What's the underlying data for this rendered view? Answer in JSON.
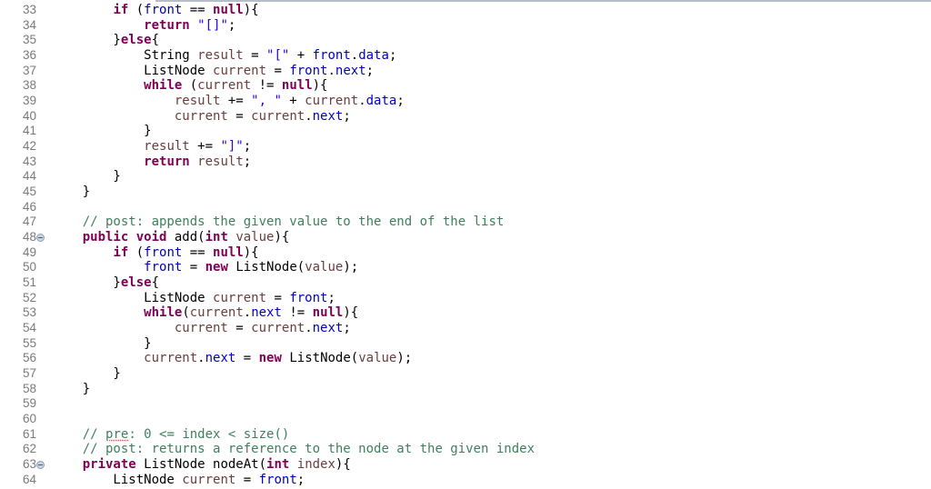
{
  "editor": {
    "fold_marker_lines": [
      48,
      63
    ],
    "accent_colors": {
      "keyword": "#7f0055",
      "field": "#0000c0",
      "string": "#2a00ff",
      "local_variable": "#6a3e3e",
      "comment": "#3f7f5f",
      "line_number": "#7a7a7a"
    },
    "lines": [
      {
        "n": "33",
        "tokens": [
          [
            "",
            "        "
          ],
          [
            "kw",
            "if"
          ],
          [
            "",
            " ("
          ],
          [
            "fd",
            "front"
          ],
          [
            "",
            " == "
          ],
          [
            "kw",
            "null"
          ],
          [
            "",
            "){"
          ]
        ]
      },
      {
        "n": "34",
        "tokens": [
          [
            "",
            "            "
          ],
          [
            "kw",
            "return"
          ],
          [
            "",
            " "
          ],
          [
            "st",
            "\"[]\""
          ],
          [
            "",
            ";"
          ]
        ]
      },
      {
        "n": "35",
        "tokens": [
          [
            "",
            "        }"
          ],
          [
            "kw",
            "else"
          ],
          [
            "",
            "{"
          ]
        ]
      },
      {
        "n": "36",
        "tokens": [
          [
            "",
            "            String "
          ],
          [
            "lv",
            "result"
          ],
          [
            "",
            " = "
          ],
          [
            "st",
            "\"[\""
          ],
          [
            "",
            " + "
          ],
          [
            "fd",
            "front"
          ],
          [
            "",
            "."
          ],
          [
            "fd",
            "data"
          ],
          [
            "",
            ";"
          ]
        ]
      },
      {
        "n": "37",
        "tokens": [
          [
            "",
            "            ListNode "
          ],
          [
            "lv",
            "current"
          ],
          [
            "",
            " = "
          ],
          [
            "fd",
            "front"
          ],
          [
            "",
            "."
          ],
          [
            "fd",
            "next"
          ],
          [
            "",
            ";"
          ]
        ]
      },
      {
        "n": "38",
        "tokens": [
          [
            "",
            "            "
          ],
          [
            "kw",
            "while"
          ],
          [
            "",
            " ("
          ],
          [
            "lv",
            "current"
          ],
          [
            "",
            " != "
          ],
          [
            "kw",
            "null"
          ],
          [
            "",
            "){"
          ]
        ]
      },
      {
        "n": "39",
        "tokens": [
          [
            "",
            "                "
          ],
          [
            "lv",
            "result"
          ],
          [
            "",
            " += "
          ],
          [
            "st",
            "\", \""
          ],
          [
            "",
            " + "
          ],
          [
            "lv",
            "current"
          ],
          [
            "",
            "."
          ],
          [
            "fd",
            "data"
          ],
          [
            "",
            ";"
          ]
        ]
      },
      {
        "n": "40",
        "tokens": [
          [
            "",
            "                "
          ],
          [
            "lv",
            "current"
          ],
          [
            "",
            " = "
          ],
          [
            "lv",
            "current"
          ],
          [
            "",
            "."
          ],
          [
            "fd",
            "next"
          ],
          [
            "",
            ";"
          ]
        ]
      },
      {
        "n": "41",
        "tokens": [
          [
            "",
            "            }"
          ]
        ]
      },
      {
        "n": "42",
        "tokens": [
          [
            "",
            "            "
          ],
          [
            "lv",
            "result"
          ],
          [
            "",
            " += "
          ],
          [
            "st",
            "\"]\""
          ],
          [
            "",
            ";"
          ]
        ]
      },
      {
        "n": "43",
        "tokens": [
          [
            "",
            "            "
          ],
          [
            "kw",
            "return"
          ],
          [
            "",
            " "
          ],
          [
            "lv",
            "result"
          ],
          [
            "",
            ";"
          ]
        ]
      },
      {
        "n": "44",
        "tokens": [
          [
            "",
            "        }"
          ]
        ]
      },
      {
        "n": "45",
        "tokens": [
          [
            "",
            "    }"
          ]
        ]
      },
      {
        "n": "46",
        "tokens": []
      },
      {
        "n": "47",
        "tokens": [
          [
            "",
            "    "
          ],
          [
            "cm",
            "// post: appends the given value to the end of the list"
          ]
        ]
      },
      {
        "n": "48",
        "tokens": [
          [
            "",
            "    "
          ],
          [
            "kw",
            "public"
          ],
          [
            "",
            " "
          ],
          [
            "kw",
            "void"
          ],
          [
            "",
            " add("
          ],
          [
            "kw",
            "int"
          ],
          [
            "",
            " "
          ],
          [
            "lv",
            "value"
          ],
          [
            "",
            "){"
          ]
        ]
      },
      {
        "n": "49",
        "tokens": [
          [
            "",
            "        "
          ],
          [
            "kw",
            "if"
          ],
          [
            "",
            " ("
          ],
          [
            "fd",
            "front"
          ],
          [
            "",
            " == "
          ],
          [
            "kw",
            "null"
          ],
          [
            "",
            "){"
          ]
        ]
      },
      {
        "n": "50",
        "tokens": [
          [
            "",
            "            "
          ],
          [
            "fd",
            "front"
          ],
          [
            "",
            " = "
          ],
          [
            "kw",
            "new"
          ],
          [
            "",
            " ListNode("
          ],
          [
            "lv",
            "value"
          ],
          [
            "",
            ");"
          ]
        ]
      },
      {
        "n": "51",
        "tokens": [
          [
            "",
            "        }"
          ],
          [
            "kw",
            "else"
          ],
          [
            "",
            "{"
          ]
        ]
      },
      {
        "n": "52",
        "tokens": [
          [
            "",
            "            ListNode "
          ],
          [
            "lv",
            "current"
          ],
          [
            "",
            " = "
          ],
          [
            "fd",
            "front"
          ],
          [
            "",
            ";"
          ]
        ]
      },
      {
        "n": "53",
        "tokens": [
          [
            "",
            "            "
          ],
          [
            "kw",
            "while"
          ],
          [
            "",
            "("
          ],
          [
            "lv",
            "current"
          ],
          [
            "",
            "."
          ],
          [
            "fd",
            "next"
          ],
          [
            "",
            " != "
          ],
          [
            "kw",
            "null"
          ],
          [
            "",
            "){"
          ]
        ]
      },
      {
        "n": "54",
        "tokens": [
          [
            "",
            "                "
          ],
          [
            "lv",
            "current"
          ],
          [
            "",
            " = "
          ],
          [
            "lv",
            "current"
          ],
          [
            "",
            "."
          ],
          [
            "fd",
            "next"
          ],
          [
            "",
            ";"
          ]
        ]
      },
      {
        "n": "55",
        "tokens": [
          [
            "",
            "            }"
          ]
        ]
      },
      {
        "n": "56",
        "tokens": [
          [
            "",
            "            "
          ],
          [
            "lv",
            "current"
          ],
          [
            "",
            "."
          ],
          [
            "fd",
            "next"
          ],
          [
            "",
            " = "
          ],
          [
            "kw",
            "new"
          ],
          [
            "",
            " ListNode("
          ],
          [
            "lv",
            "value"
          ],
          [
            "",
            ");"
          ]
        ]
      },
      {
        "n": "57",
        "tokens": [
          [
            "",
            "        }"
          ]
        ]
      },
      {
        "n": "58",
        "tokens": [
          [
            "",
            "    }"
          ]
        ]
      },
      {
        "n": "59",
        "tokens": []
      },
      {
        "n": "60",
        "tokens": []
      },
      {
        "n": "61",
        "tokens": [
          [
            "",
            "    "
          ],
          [
            "cm",
            "// "
          ],
          [
            "cm spell",
            "pre"
          ],
          [
            "cm",
            ": 0 <= index < size()"
          ]
        ]
      },
      {
        "n": "62",
        "tokens": [
          [
            "",
            "    "
          ],
          [
            "cm",
            "// post: returns a reference to the node at the given index"
          ]
        ]
      },
      {
        "n": "63",
        "tokens": [
          [
            "",
            "    "
          ],
          [
            "kw",
            "private"
          ],
          [
            "",
            " ListNode nodeAt("
          ],
          [
            "kw",
            "int"
          ],
          [
            "",
            " "
          ],
          [
            "lv",
            "index"
          ],
          [
            "",
            "){"
          ]
        ]
      },
      {
        "n": "64",
        "tokens": [
          [
            "",
            "        ListNode "
          ],
          [
            "lv",
            "current"
          ],
          [
            "",
            " = "
          ],
          [
            "fd",
            "front"
          ],
          [
            "",
            ";"
          ]
        ]
      }
    ]
  }
}
